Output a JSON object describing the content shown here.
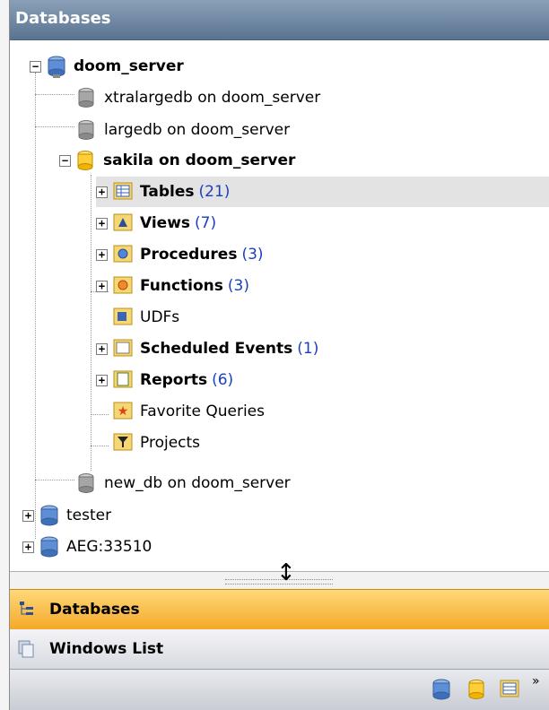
{
  "panel": {
    "title": "Databases"
  },
  "tree": {
    "server": "doom_server",
    "dbs": [
      "xtralargedb on doom_server",
      "largedb on doom_server",
      "sakila on doom_server",
      "new_db on doom_server"
    ],
    "items": [
      {
        "label": "Tables",
        "count": "(21)"
      },
      {
        "label": "Views",
        "count": "(7)"
      },
      {
        "label": "Procedures",
        "count": "(3)"
      },
      {
        "label": "Functions",
        "count": "(3)"
      },
      {
        "label": "UDFs"
      },
      {
        "label": "Scheduled Events",
        "count": "(1)"
      },
      {
        "label": "Reports",
        "count": "(6)"
      },
      {
        "label": "Favorite Queries"
      },
      {
        "label": "Projects"
      }
    ],
    "other_servers": [
      "tester",
      "AEG:33510"
    ]
  },
  "bottom": {
    "databases": "Databases",
    "windows": "Windows List",
    "more": "»"
  },
  "colors": {
    "accent": "#f4a928",
    "title": "#6a829e",
    "count": "#1a3fbf"
  }
}
